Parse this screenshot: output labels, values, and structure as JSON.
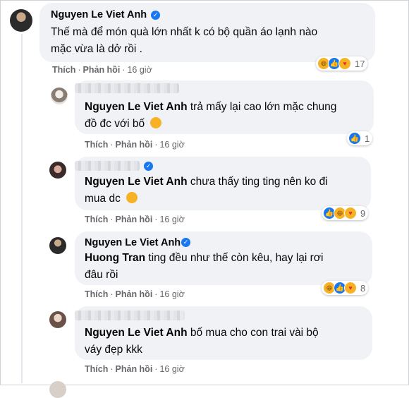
{
  "comments": [
    {
      "name": "Nguyen Le Viet Anh",
      "text": "Thế mà để món quà lớn nhất k có bộ quần áo lạnh nào mặc vừa là dở rồi .",
      "text_line1": "Thế mà để món quà lớn nhất k có bộ quần áo lạnh nào",
      "text_line2": "mặc vừa là dở rồi .",
      "actions": {
        "like": "Thích",
        "reply": "Phản hồi",
        "time": "16 giờ"
      },
      "reaction_count": "17"
    },
    {
      "name": "",
      "mention": "Nguyen Le Viet Anh",
      "text_line1": "trả mấy lại cao lớn mặc chung",
      "text_line2": "đồ đc với bố",
      "actions": {
        "like": "Thích",
        "reply": "Phản hồi",
        "time": "16 giờ"
      },
      "reaction_count": "1"
    },
    {
      "name": "",
      "mention": "Nguyen Le Viet Anh",
      "text_line1": "chưa thấy ting ting nên ko đi",
      "text_line2": "mua dc",
      "actions": {
        "like": "Thích",
        "reply": "Phản hồi",
        "time": "16 giờ"
      },
      "reaction_count": "9"
    },
    {
      "name": "Nguyen Le Viet Anh",
      "mention": "Huong Tran",
      "text_line1": "ting đều như thế còn kêu, hay lại rơi",
      "text_line2": "đâu rồi",
      "actions": {
        "like": "Thích",
        "reply": "Phản hồi",
        "time": "16 giờ"
      },
      "reaction_count": "8"
    },
    {
      "name": "",
      "mention": "Nguyen Le Viet Anh",
      "text_line1": "bố mua cho con trai vài bộ",
      "text_line2": "váy đẹp kkk",
      "actions": {
        "like": "Thích",
        "reply": "Phản hồi",
        "time": "16 giờ"
      }
    }
  ],
  "colors": {
    "verified": "#1877f2",
    "bubble": "#f0f2f5",
    "meta": "#65676b"
  },
  "icons": [
    "verified-badge-icon",
    "like-reaction-icon",
    "haha-reaction-icon",
    "care-reaction-icon"
  ]
}
